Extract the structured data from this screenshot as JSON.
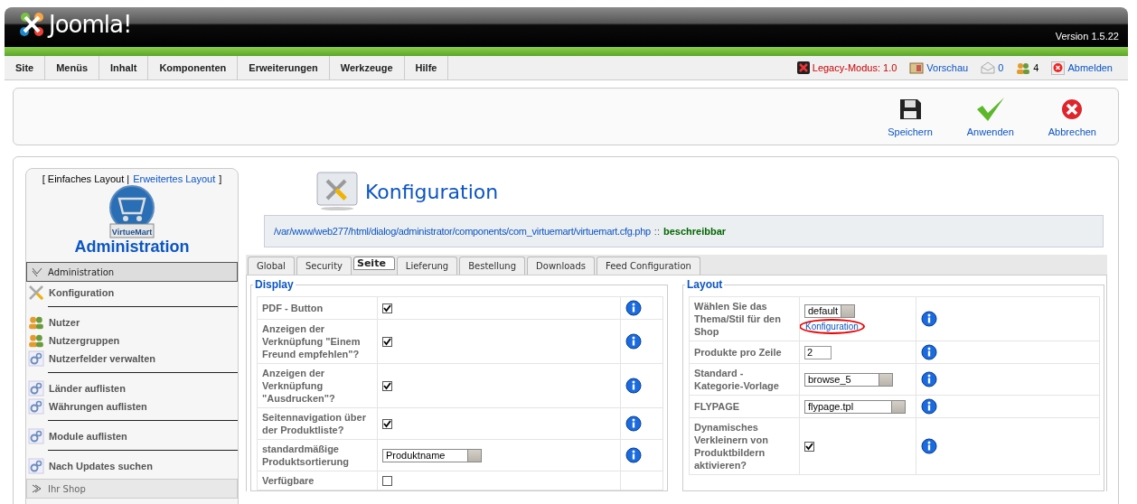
{
  "header": {
    "brand": "Joomla!",
    "version": "Version 1.5.22"
  },
  "menu": [
    {
      "label": "Site"
    },
    {
      "label": "Menüs"
    },
    {
      "label": "Inhalt"
    },
    {
      "label": "Komponenten"
    },
    {
      "label": "Erweiterungen"
    },
    {
      "label": "Werkzeuge"
    },
    {
      "label": "Hilfe"
    }
  ],
  "status": [
    {
      "kind": "legacy",
      "text": "Legacy-Modus: 1.0"
    },
    {
      "kind": "preview",
      "text": "Vorschau"
    },
    {
      "kind": "messages",
      "text": "0"
    },
    {
      "kind": "users",
      "text": "4"
    },
    {
      "kind": "logout",
      "text": "Abmelden"
    }
  ],
  "toolbar": [
    {
      "kind": "save",
      "label": "Speichern"
    },
    {
      "kind": "apply",
      "label": "Anwenden"
    },
    {
      "kind": "cancel",
      "label": "Abbrechen"
    }
  ],
  "sidebar": {
    "layout_prefix": "[ Einfaches Layout |",
    "layout_link": "Erweitertes Layout",
    "layout_suffix": "]",
    "logo_text": "VirtueMart",
    "title": "Administration",
    "sections": [
      {
        "label": "Administration",
        "expanded": true,
        "groups": [
          [
            {
              "kind": "tools",
              "label": "Konfiguration"
            }
          ],
          [
            {
              "kind": "users",
              "label": "Nutzer"
            },
            {
              "kind": "users",
              "label": "Nutzergruppen"
            },
            {
              "kind": "fields",
              "label": "Nutzerfelder verwalten"
            }
          ],
          [
            {
              "kind": "fields",
              "label": "Länder auflisten"
            },
            {
              "kind": "fields",
              "label": "Währungen auflisten"
            }
          ],
          [
            {
              "kind": "fields",
              "label": "Module auflisten"
            }
          ],
          [
            {
              "kind": "fields",
              "label": "Nach Updates suchen"
            }
          ]
        ]
      },
      {
        "label": "Ihr Shop",
        "expanded": false
      }
    ]
  },
  "page": {
    "title": "Konfiguration",
    "path": "/var/www/web277/html/dialog/administrator/components/com_virtuemart/virtuemart.cfg.php",
    "path_sep": "::",
    "path_status": "beschreibbar"
  },
  "tabs": [
    {
      "label": "Global",
      "selected": false
    },
    {
      "label": "Security",
      "selected": false
    },
    {
      "label": "Seite",
      "selected": true
    },
    {
      "label": "Lieferung",
      "selected": false
    },
    {
      "label": "Bestellung",
      "selected": false
    },
    {
      "label": "Downloads",
      "selected": false
    },
    {
      "label": "Feed Configuration",
      "selected": false
    }
  ],
  "display": {
    "legend": "Display",
    "rows": [
      {
        "kind": "checkbox",
        "label": "PDF - Button",
        "checked": true
      },
      {
        "kind": "checkbox",
        "label": "Anzeigen der Verknüpfung \"Einem Freund empfehlen\"?",
        "checked": true
      },
      {
        "kind": "checkbox",
        "label": "Anzeigen der Verknüpfung \"Ausdrucken\"?",
        "checked": true
      },
      {
        "kind": "checkbox",
        "label": "Seitennavigation über der Produktliste?",
        "checked": true
      },
      {
        "kind": "select",
        "label": "standardmäßige Produktsortierung",
        "value": "Produktname"
      },
      {
        "kind": "checkbox",
        "label": "Verfügbare",
        "checked": false
      }
    ]
  },
  "layout": {
    "legend": "Layout",
    "rows": [
      {
        "kind": "theme",
        "label": "Wählen Sie das Thema/Stil für den Shop",
        "value": "default",
        "link": "Konfiguration"
      },
      {
        "kind": "text",
        "label": "Produkte pro Zeile",
        "value": "2"
      },
      {
        "kind": "select",
        "label": "Standard - Kategorie-Vorlage",
        "value": "browse_5"
      },
      {
        "kind": "select",
        "label": "FLYPAGE",
        "value": "flypage.tpl"
      },
      {
        "kind": "checkbox",
        "label": "Dynamisches Verkleinern von Produktbildern aktivieren?",
        "checked": true
      }
    ]
  }
}
